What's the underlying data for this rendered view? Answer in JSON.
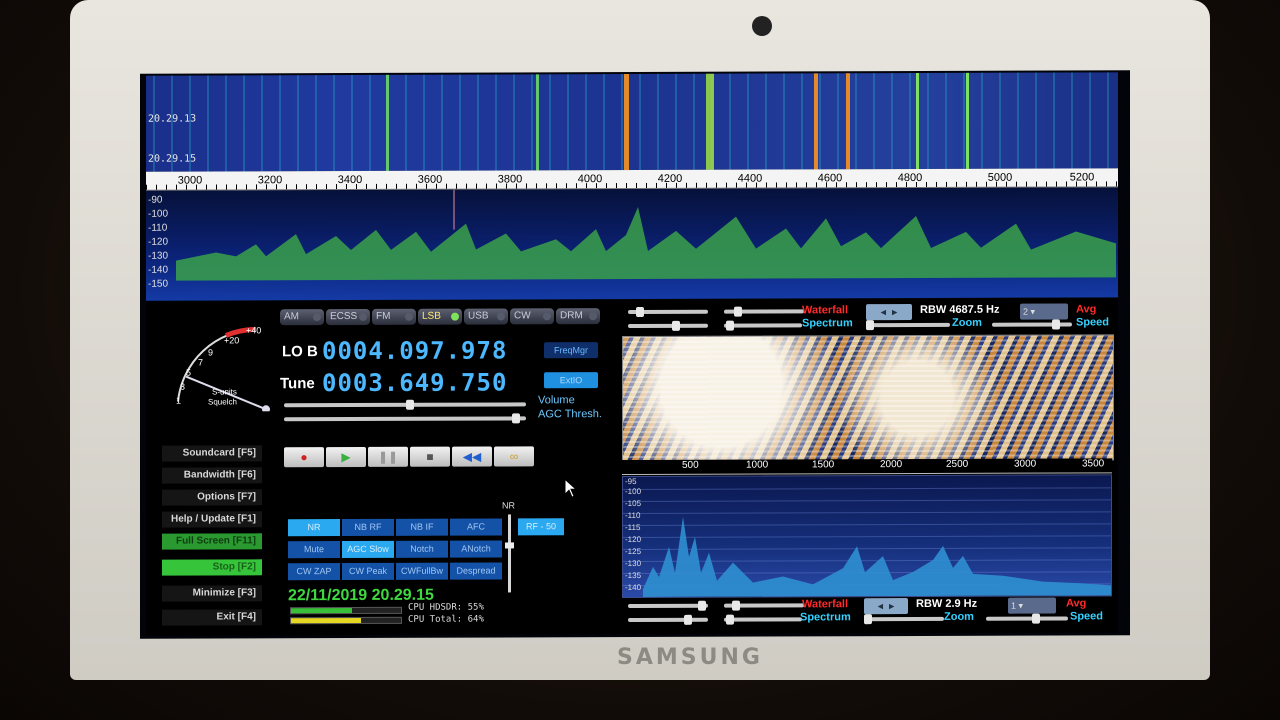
{
  "waterfall_top": {
    "times": [
      "20.29.13",
      "20.29.15"
    ],
    "freq_labels": [
      "3000",
      "3200",
      "3400",
      "3600",
      "3800",
      "4000",
      "4200",
      "4400",
      "4600",
      "4800",
      "5000",
      "5200"
    ]
  },
  "spectrum_top": {
    "db_labels": [
      "-90",
      "-100",
      "-110",
      "-120",
      "-130",
      "-140",
      "-150"
    ]
  },
  "modes": [
    {
      "label": "AM",
      "active": false
    },
    {
      "label": "ECSS",
      "active": false
    },
    {
      "label": "FM",
      "active": false
    },
    {
      "label": "LSB",
      "active": true
    },
    {
      "label": "USB",
      "active": false
    },
    {
      "label": "CW",
      "active": false
    },
    {
      "label": "DRM",
      "active": false
    }
  ],
  "lo": {
    "label": "LO B",
    "value": "0004.097.978"
  },
  "tune": {
    "label": "Tune",
    "value": "0003.649.750"
  },
  "freqmgr_label": "FreqMgr",
  "extio_label": "ExtIO",
  "smeter": {
    "label1": "S-units",
    "label2": "Squelch",
    "scale": [
      "+40",
      "+20",
      "9",
      "7",
      "5",
      "3",
      "1"
    ]
  },
  "volume_label": "Volume",
  "agc_label": "AGC Thresh.",
  "side_buttons": [
    "Soundcard [F5]",
    "Bandwidth [F6]",
    "Options [F7]",
    "Help / Update [F1]",
    "Full Screen [F11]",
    "Stop [F2]",
    "Minimize [F3]",
    "Exit [F4]"
  ],
  "dsp": {
    "nr_label": "NR",
    "rows": [
      [
        {
          "label": "NR",
          "on": true
        },
        {
          "label": "NB RF",
          "on": false
        },
        {
          "label": "NB IF",
          "on": false
        },
        {
          "label": "AFC",
          "on": false
        }
      ],
      [
        {
          "label": "Mute",
          "on": false
        },
        {
          "label": "AGC Slow",
          "on": true
        },
        {
          "label": "Notch",
          "on": false
        },
        {
          "label": "ANotch",
          "on": false
        }
      ],
      [
        {
          "label": "CW ZAP",
          "on": false
        },
        {
          "label": "CW Peak",
          "on": false
        },
        {
          "label": "CWFullBw",
          "on": false
        },
        {
          "label": "Despread",
          "on": false
        }
      ]
    ],
    "rf_label": "RF - 50"
  },
  "datetime": "22/11/2019 20.29.15",
  "cpu": {
    "hdsdr": "CPU HDSDR: 55%",
    "total": "CPU Total: 64%",
    "hdsdr_level": 0.55,
    "total_level": 0.64
  },
  "rf_panel": {
    "waterfall": "Waterfall",
    "spectrum": "Spectrum",
    "rbw": "RBW 4687.5 Hz",
    "rbw_select": "2",
    "zoom": "Zoom",
    "avg": "Avg",
    "speed": "Speed"
  },
  "af_panel": {
    "freq_labels": [
      "500",
      "1000",
      "1500",
      "2000",
      "2500",
      "3000",
      "3500"
    ],
    "db_labels": [
      "-95",
      "-100",
      "-105",
      "-110",
      "-115",
      "-120",
      "-125",
      "-130",
      "-135",
      "-140"
    ],
    "waterfall": "Waterfall",
    "spectrum": "Spectrum",
    "rbw": "RBW  2.9 Hz",
    "rbw_select": "1",
    "zoom": "Zoom",
    "avg": "Avg",
    "speed": "Speed"
  },
  "laptop_brand": "SAMSUNG",
  "colors": {
    "accent": "#4cb8ff",
    "wf_label": "#ff2a2a",
    "spec_label": "#36d1ff",
    "green": "#36c43a"
  }
}
